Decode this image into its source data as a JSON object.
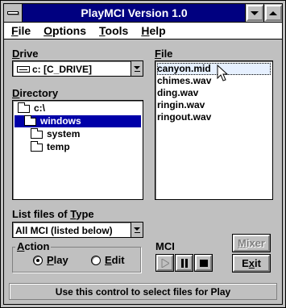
{
  "window": {
    "title": "PlayMCI Version 1.0"
  },
  "menu": [
    {
      "label": "File",
      "accel": "F",
      "rest": "ile"
    },
    {
      "label": "Options",
      "accel": "O",
      "rest": "ptions"
    },
    {
      "label": "Tools",
      "accel": "T",
      "rest": "ools"
    },
    {
      "label": "Help",
      "accel": "H",
      "rest": "elp"
    }
  ],
  "drive": {
    "label_accel": "D",
    "label_rest": "rive",
    "value": "c: [C_DRIVE]"
  },
  "directory": {
    "label_accel": "D",
    "label_rest": "irectory",
    "items": [
      {
        "label": "c:\\",
        "icon": "open-folder-icon",
        "selected": false
      },
      {
        "label": "windows",
        "icon": "open-folder-icon",
        "selected": true
      },
      {
        "label": "system",
        "icon": "folder-icon",
        "selected": false
      },
      {
        "label": "temp",
        "icon": "folder-icon",
        "selected": false
      }
    ]
  },
  "file": {
    "label_accel": "F",
    "label_rest": "ile",
    "items": [
      "canyon.mid",
      "chimes.wav",
      "ding.wav",
      "ringin.wav",
      "ringout.wav"
    ],
    "focused_index": 0
  },
  "list_type": {
    "label_pre": "List files of ",
    "label_accel": "T",
    "label_rest": "ype",
    "value": "All MCI (listed below)"
  },
  "action": {
    "label_accel": "A",
    "label_rest": "ction",
    "play_accel": "P",
    "play_rest": "lay",
    "edit_accel": "E",
    "edit_rest": "dit",
    "selected": "play"
  },
  "mci": {
    "label": "MCI"
  },
  "buttons": {
    "mixer_accel": "M",
    "mixer_rest": "ixer",
    "exit_accel": "x",
    "exit_pre": "E",
    "exit_rest": "it"
  },
  "status": {
    "text": "Use this control to select files for Play"
  },
  "colors": {
    "titlebar": "#000080",
    "face": "#c0c0c0",
    "selection": "#0000a8"
  }
}
